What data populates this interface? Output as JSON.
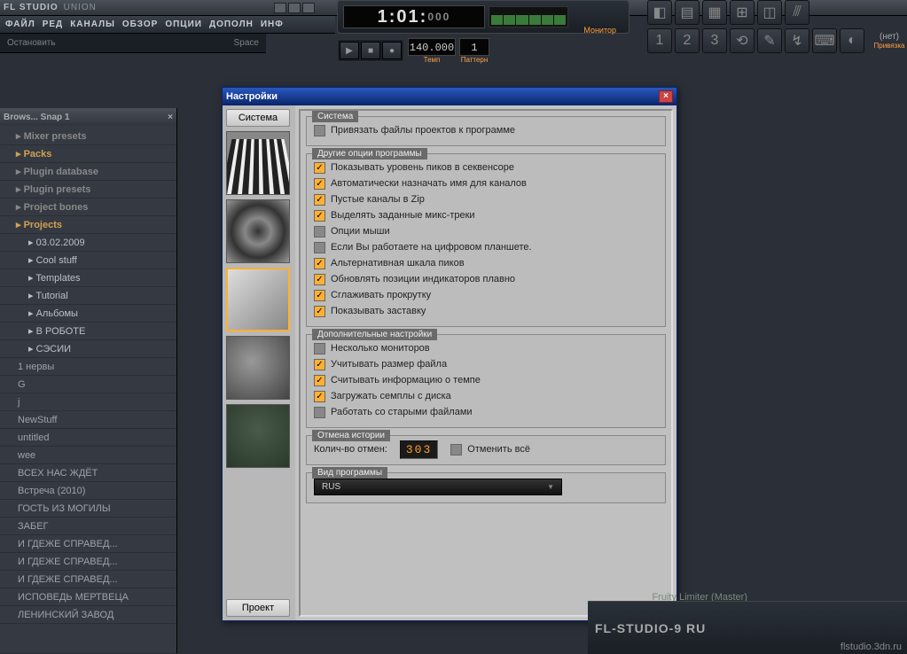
{
  "app": {
    "name": "FL STUDIO",
    "project": "UNION"
  },
  "menu": [
    "ФАЙЛ",
    "РЕД",
    "КАНАЛЫ",
    "ОБЗОР",
    "ОПЦИИ",
    "ДОПОЛН",
    "ИНФ"
  ],
  "hint": {
    "left": "Остановить",
    "right": "Space"
  },
  "transport": {
    "time": "1:01:",
    "time_ms": "000",
    "monitor": "Монитор",
    "tempo": "140.000",
    "tempo_label": "Темп",
    "pattern_label": "Паттерн"
  },
  "snap": {
    "label": "(нет)",
    "bind": "Привязка"
  },
  "browser": {
    "title": "Brows...  Snap 1",
    "items": [
      {
        "label": "Mixer presets",
        "kind": "folder-gray"
      },
      {
        "label": "Packs",
        "kind": "folder"
      },
      {
        "label": "Plugin database",
        "kind": "folder-gray"
      },
      {
        "label": "Plugin presets",
        "kind": "folder-gray"
      },
      {
        "label": "Project bones",
        "kind": "folder-gray"
      },
      {
        "label": "Projects",
        "kind": "folder"
      },
      {
        "label": "03.02.2009",
        "kind": "sub"
      },
      {
        "label": "Cool stuff",
        "kind": "sub"
      },
      {
        "label": "Templates",
        "kind": "sub"
      },
      {
        "label": "Tutorial",
        "kind": "sub"
      },
      {
        "label": "Альбомы",
        "kind": "sub"
      },
      {
        "label": "В РОБОТЕ",
        "kind": "sub"
      },
      {
        "label": "СЭСИИ",
        "kind": "sub"
      },
      {
        "label": "1 нервы",
        "kind": "file"
      },
      {
        "label": "G",
        "kind": "file"
      },
      {
        "label": "j",
        "kind": "file"
      },
      {
        "label": "NewStuff",
        "kind": "file"
      },
      {
        "label": "untitled",
        "kind": "file"
      },
      {
        "label": "wee",
        "kind": "file"
      },
      {
        "label": "ВСЕХ НАС ЖДЁТ",
        "kind": "file"
      },
      {
        "label": "Встреча (2010)",
        "kind": "file"
      },
      {
        "label": "ГОСТЬ ИЗ МОГИЛЫ",
        "kind": "file"
      },
      {
        "label": "ЗАБЕГ",
        "kind": "file"
      },
      {
        "label": "И ГДЕЖЕ СПРАВЕД...",
        "kind": "file"
      },
      {
        "label": "И ГДЕЖЕ СПРАВЕД...",
        "kind": "file"
      },
      {
        "label": "И ГДЕЖЕ СПРАВЕД...",
        "kind": "file"
      },
      {
        "label": "ИСПОВЕДЬ МЕРТВЕЦА",
        "kind": "file"
      },
      {
        "label": "ЛЕНИНСКИЙ ЗАВОД",
        "kind": "file"
      }
    ]
  },
  "dialog": {
    "title": "Настройки",
    "tab_system": "Система",
    "tab_project": "Проект",
    "cats": [
      "MIDI",
      "AUDIO",
      "GENERAL",
      "FILE",
      "DEBUG"
    ],
    "group_system": {
      "title": "Система",
      "items": [
        {
          "checked": false,
          "label": "Привязать файлы проектов к программе"
        }
      ]
    },
    "group_other": {
      "title": "Другие опции программы",
      "items": [
        {
          "checked": true,
          "label": "Показывать уровень пиков в секвенсоре"
        },
        {
          "checked": true,
          "label": "Автоматически назначать имя для каналов"
        },
        {
          "checked": true,
          "label": "Пустые каналы в Zip"
        },
        {
          "checked": true,
          "label": "Выделять заданные микс-треки"
        },
        {
          "checked": false,
          "label": "Опции мыши"
        },
        {
          "checked": false,
          "label": "Если Вы работаете на цифровом планшете."
        },
        {
          "checked": true,
          "label": "Альтернативная шкала пиков"
        },
        {
          "checked": true,
          "label": "Обновлять позиции индикаторов плавно"
        },
        {
          "checked": true,
          "label": "Сглаживать прокрутку"
        },
        {
          "checked": true,
          "label": "Показывать заставку"
        }
      ]
    },
    "group_extra": {
      "title": "Дополнительные настройки",
      "items": [
        {
          "checked": false,
          "label": "Несколько мониторов"
        },
        {
          "checked": true,
          "label": "Учитывать размер файла"
        },
        {
          "checked": true,
          "label": "Считывать информацию о темпе"
        },
        {
          "checked": true,
          "label": "Загружать семплы с диска"
        },
        {
          "checked": false,
          "label": "Работать со старыми файлами"
        }
      ]
    },
    "group_undo": {
      "title": "Отмена истории",
      "count_label": "Колич-во отмен:",
      "count": "303",
      "cancel_all": "Отменить всё"
    },
    "group_lang": {
      "title": "Вид программы",
      "value": "RUS"
    }
  },
  "bottom": {
    "plugin": "Fruity Limiter (Master)",
    "brand": "FL-STUDIO-9 RU",
    "url": "flstudio.3dn.ru"
  }
}
